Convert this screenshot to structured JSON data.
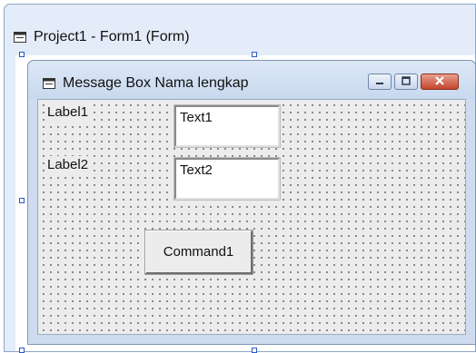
{
  "project_window": {
    "title": "Project1 - Form1 (Form)",
    "icon": "form-window-icon"
  },
  "form": {
    "title": "Message Box Nama lengkap",
    "icon": "form-window-icon",
    "caption_buttons": [
      "minimize-icon",
      "maximize-icon",
      "close-icon"
    ]
  },
  "controls": {
    "label1": "Label1",
    "label2": "Label2",
    "text1": "Text1",
    "text2": "Text2",
    "command1": "Command1"
  },
  "colors": {
    "close_button": "#c4452c",
    "selection_handle": "#2b59c3",
    "form_background": "#ececec",
    "title_bar": "#cfdcef"
  }
}
